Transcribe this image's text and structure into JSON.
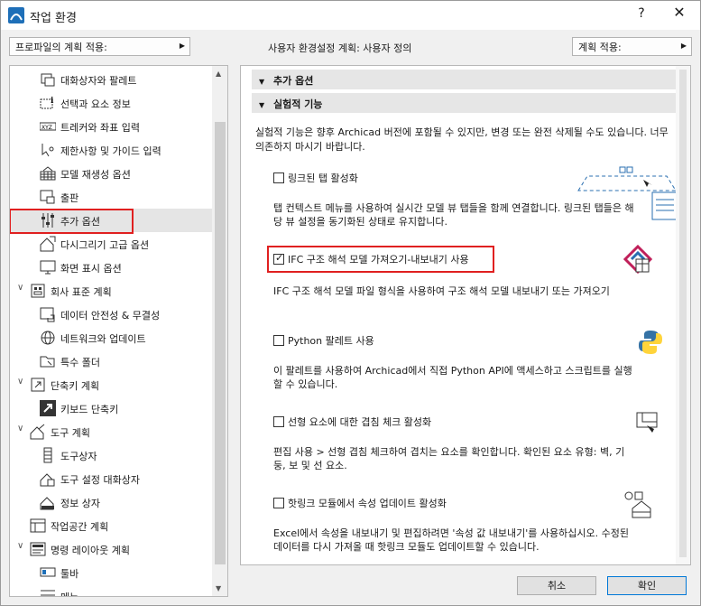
{
  "window": {
    "title": "작업 환경",
    "help_glyph": "?",
    "close_glyph": "✕"
  },
  "topbar": {
    "profile_apply": "프로파일의 계획 적용:",
    "scheme_label": "사용자 환경설정 계획:  사용자 정의",
    "scheme_apply": "계획 적용:"
  },
  "tree": {
    "items": [
      {
        "label": "대화상자와 팔레트",
        "icon": "dialog-palette-icon"
      },
      {
        "label": "선택과 요소 정보",
        "icon": "selection-info-icon"
      },
      {
        "label": "트레커와 좌표 입력",
        "icon": "tracker-coords-icon",
        "icon_text": "XYZ"
      },
      {
        "label": "제한사항 및 가이드 입력",
        "icon": "constraints-guides-icon"
      },
      {
        "label": "모델 재생성 옵션",
        "icon": "model-rebuild-icon"
      },
      {
        "label": "출판",
        "icon": "publish-icon"
      },
      {
        "label": "추가 옵션",
        "icon": "more-options-icon"
      },
      {
        "label": "다시그리기 고급 옵션",
        "icon": "redraw-advanced-icon"
      },
      {
        "label": "화면 표시 옵션",
        "icon": "on-screen-options-icon"
      },
      {
        "label": "회사 표준 계획",
        "icon": "company-standards-icon"
      },
      {
        "label": "데이터 안전성 & 무결성",
        "icon": "data-safety-icon"
      },
      {
        "label": "네트워크와 업데이트",
        "icon": "network-update-icon"
      },
      {
        "label": "특수 폴더",
        "icon": "special-folders-icon"
      },
      {
        "label": "단축키 계획",
        "icon": "shortcut-schemes-icon"
      },
      {
        "label": "키보드 단축키",
        "icon": "keyboard-shortcuts-icon"
      },
      {
        "label": "도구 계획",
        "icon": "tool-schemes-icon"
      },
      {
        "label": "도구상자",
        "icon": "toolbox-icon"
      },
      {
        "label": "도구 설정 대화상자",
        "icon": "tool-settings-icon"
      },
      {
        "label": "정보 상자",
        "icon": "info-box-icon"
      },
      {
        "label": "작업공간 계획",
        "icon": "workspace-schemes-icon"
      },
      {
        "label": "명령 레이아웃 계획",
        "icon": "command-layout-icon"
      },
      {
        "label": "툴바",
        "icon": "toolbar-icon"
      },
      {
        "label": "메뉴",
        "icon": "menu-icon"
      }
    ]
  },
  "content": {
    "section_more": "추가 옵션",
    "section_experimental": "실험적 기능",
    "notice": "실험적 기능은 향후 Archicad 버전에 포함될 수 있지만, 변경 또는 완전 삭제될 수도 있습니다. 너무 의존하지 마시기 바랍니다.",
    "options": [
      {
        "label": "링크된 탭 활성화",
        "checked": false,
        "icon": "linked-tabs-icon",
        "desc": "탭 컨텍스트 메뉴를 사용하여 실시간 모델 뷰 탭들을 함께 연결합니다. 링크된 탭들은 해당 뷰 설정을 동기화된 상태로 유지합니다."
      },
      {
        "label": "IFC 구조 해석 모델 가져오기-내보내기 사용",
        "checked": true,
        "icon": "ifc-structural-icon",
        "desc": "IFC 구조 해석 모델 파일 형식을 사용하여 구조 해석 모델 내보내기 또는 가져오기"
      },
      {
        "label": "Python 팔레트 사용",
        "checked": false,
        "icon": "python-icon",
        "desc": "이 팔레트를 사용하여 Archicad에서 직접 Python API에 액세스하고 스크립트를 실행할 수 있습니다."
      },
      {
        "label": "선형 요소에 대한 겹침 체크 활성화",
        "checked": false,
        "icon": "overlap-check-icon",
        "desc": "편집 사용 > 선형 겹침 체크하여 겹치는 요소를 확인합니다. 확인된 요소 유형: 벽, 기둥, 보 및 선 요소."
      },
      {
        "label": "핫링크 모듈에서 속성 업데이트 활성화",
        "checked": false,
        "icon": "hotlink-properties-icon",
        "desc": "Excel에서 속성을 내보내기 및 편집하려면 '속성 값 내보내기'를 사용하십시오. 수정된 데이터를 다시 가져올 때 핫링크 모듈도 업데이트할 수 있습니다."
      }
    ]
  },
  "buttons": {
    "cancel": "취소",
    "ok": "확인"
  },
  "colors": {
    "highlight": "#e02020",
    "primary_border": "#0078d7"
  }
}
